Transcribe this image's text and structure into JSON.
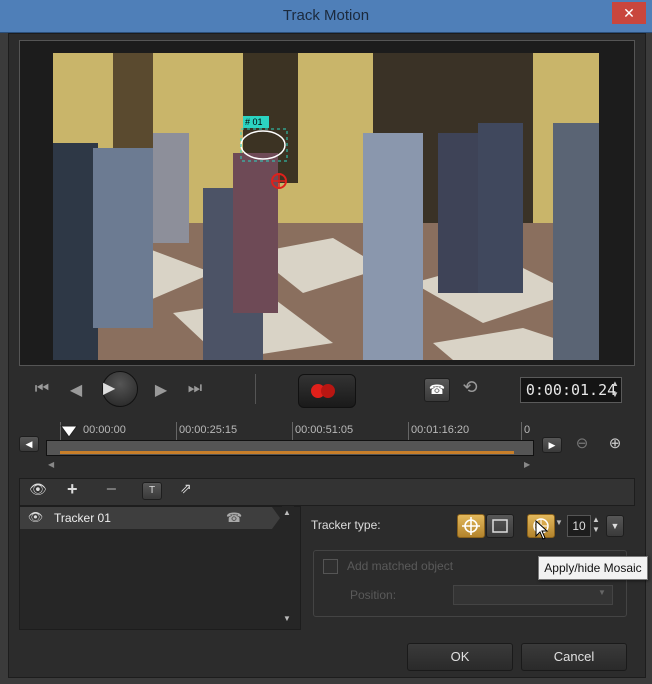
{
  "window": {
    "title": "Track Motion",
    "close_glyph": "✕"
  },
  "preview": {
    "tracker_label": "# 01"
  },
  "playback": {
    "timecode": "0:00:01.24"
  },
  "timeline": {
    "ticks": [
      "00:00:00",
      "00:00:25:15",
      "00:00:51:05",
      "00:01:16:20",
      "0"
    ]
  },
  "tracker_list": {
    "items": [
      {
        "label": "Tracker 01"
      }
    ]
  },
  "properties": {
    "tracker_type_label": "Tracker type:",
    "mosaic_size": "10",
    "add_matched_object_label": "Add matched object",
    "position_label": "Position:",
    "tooltip": "Apply/hide Mosaic"
  },
  "footer": {
    "ok_label": "OK",
    "cancel_label": "Cancel"
  },
  "colors": {
    "title_bar": "#4f7fb8",
    "accent_orange": "#c87f2a",
    "record_red": "#e0201b",
    "tracker_cyan": "#2bd4c2"
  },
  "icons": {
    "first_frame": "first-frame-icon",
    "prev_frame": "prev-frame-icon",
    "play": "play-icon",
    "next_frame": "next-frame-icon",
    "last_frame": "last-frame-icon",
    "record": "record-icon",
    "path": "path-icon",
    "history": "history-icon"
  }
}
